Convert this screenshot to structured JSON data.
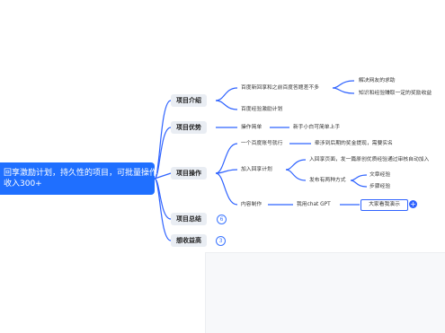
{
  "root": {
    "line1": "回享激励计划，持久性的项目，可批量操作",
    "line2": "收入300+"
  },
  "branches": {
    "intro": "项目介绍",
    "advantage": "项目优势",
    "operation": "项目操作",
    "summary": "项目总结",
    "income": "想收益高"
  },
  "badges": {
    "summary_count": "6",
    "income_count": "3"
  },
  "intro": {
    "leaf1": "百度新回享和之前百度答题差不多",
    "leaf1_child1": "解决网友的求助",
    "leaf1_child2": "知识和经验赚取一定的奖励收益",
    "leaf2": "百度经验激励计划"
  },
  "advantage": {
    "leaf1": "操作简单",
    "leaf1_child": "新手小白可简单上手"
  },
  "operation": {
    "leaf1": "一个百度账号就行",
    "leaf1_child": "牵涉到后期的奖金提现，需要实名",
    "leaf2": "加入回享计划",
    "leaf2_child1": "入回享页面，发一篇原创优质经验通过审核自动加入",
    "leaf2_child2": "发布有两种方式",
    "leaf2_child2_a": "文章经验",
    "leaf2_child2_b": "步骤经验",
    "leaf3": "内容制作",
    "leaf3_child": "我用chat  GPT",
    "leaf3_selected": "大家看我演示"
  },
  "colors": {
    "accent": "#1f6fff",
    "connector": "#2f63ff",
    "branch_bg": "#e9edf3"
  }
}
